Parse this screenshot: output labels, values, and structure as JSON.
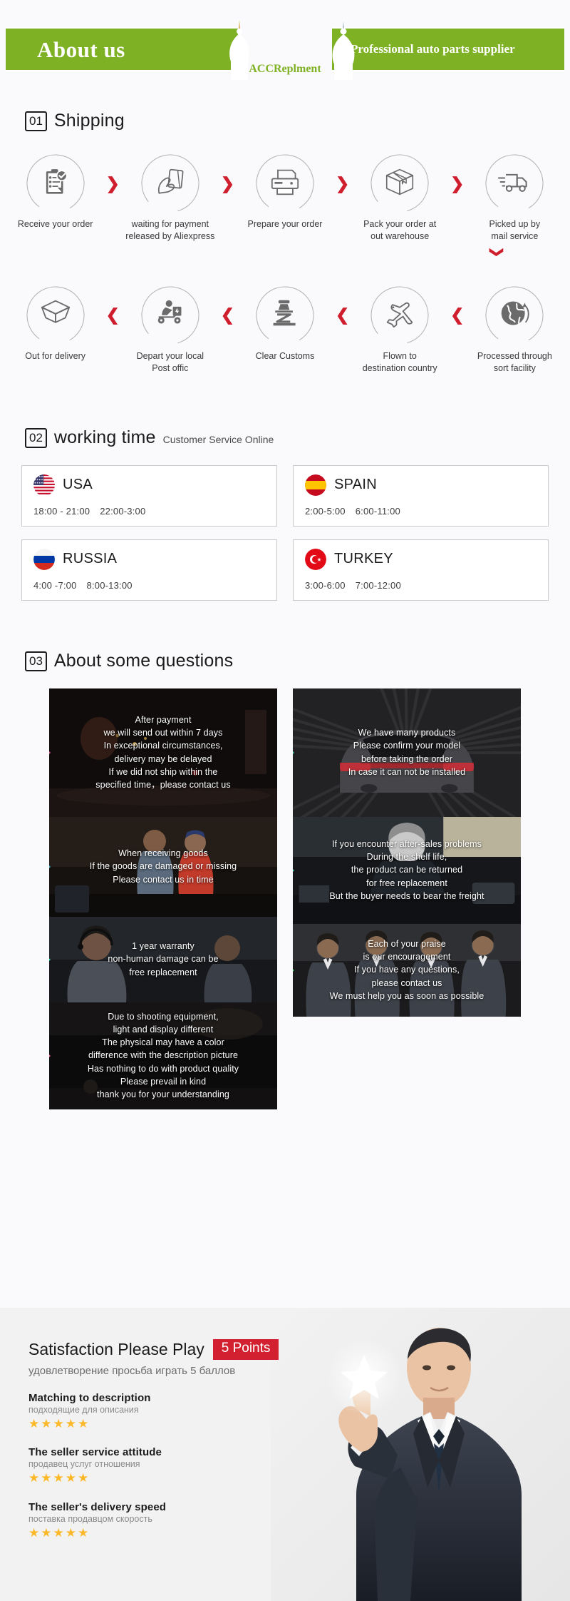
{
  "header": {
    "title": "About us",
    "tagline": "Professional auto parts supplier",
    "logo": "ACCReplment",
    "brand_green": "#7fb125"
  },
  "shipping": {
    "number": "01",
    "name": "Shipping",
    "row1": [
      {
        "label": "Receive your order",
        "icon": "clipboard-check-icon"
      },
      {
        "label": "waiting for payment\nreleased by Aliexpress",
        "icon": "hand-card-icon"
      },
      {
        "label": "Prepare your order",
        "icon": "printer-icon"
      },
      {
        "label": "Pack your order at\nout warehouse",
        "icon": "box-icon"
      },
      {
        "label": "Picked up by\nmail service",
        "icon": "truck-icon"
      }
    ],
    "row2": [
      {
        "label": "Out  for delivery",
        "icon": "open-box-icon"
      },
      {
        "label": "Depart your local\nPost offic",
        "icon": "scooter-courier-icon"
      },
      {
        "label": "Clear Customs",
        "icon": "customs-stamp-icon"
      },
      {
        "label": "Flown to\ndestination country",
        "icon": "airplane-icon"
      },
      {
        "label": "Processed through\nsort facility",
        "icon": "globe-icon"
      }
    ],
    "arrow_right": "❯",
    "arrow_left": "❮",
    "arrow_down": "❯",
    "arrow_color": "#cf1f2e"
  },
  "working_time": {
    "number": "02",
    "name": "working time",
    "subtitle": "Customer Service Online",
    "cards": [
      {
        "country": "USA",
        "flag": "usa-flag-icon",
        "hours": [
          "18:00 - 21:00",
          "22:00-3:00"
        ]
      },
      {
        "country": "SPAIN",
        "flag": "spain-flag-icon",
        "hours": [
          "2:00-5:00",
          "6:00-11:00"
        ]
      },
      {
        "country": "RUSSIA",
        "flag": "russia-flag-icon",
        "hours": [
          "4:00 -7:00",
          "8:00-13:00"
        ]
      },
      {
        "country": "TURKEY",
        "flag": "turkey-flag-icon",
        "hours": [
          "3:00-6:00",
          "7:00-12:00"
        ]
      }
    ]
  },
  "questions": {
    "number": "03",
    "name": "About some questions",
    "left_panels": [
      {
        "text": "After payment\nwe will send out within 7 days\nIn exceptional circumstances,\ndelivery may be delayed\nIf we did not ship within the\nspecified time，please contact us",
        "tag_color": "pink",
        "scene": "night-street"
      },
      {
        "text": "When receiving goods\nIf the goods are damaged or missing\nPlease contact us in time",
        "tag_color": "blue",
        "scene": "delivery-men"
      },
      {
        "text": "1 year warranty\nnon-human damage can be\nfree replacement",
        "tag_color": "teal",
        "scene": "headset-agent"
      },
      {
        "text": "Due to shooting equipment,\nlight and display different\nThe physical may have a color\ndifference with the description picture\nHas nothing to do with product quality\nPlease prevail in kind\nthank you for your understanding",
        "tag_color": "pink",
        "scene": "dark-workshop"
      }
    ],
    "right_panels": [
      {
        "text": "We have many products\nPlease confirm your model\nbefore taking the order\nIn case it can not be installed",
        "tag_color": "teal",
        "scene": "car-rear"
      },
      {
        "text": "If you encounter after-sales problems\nDuring the shelf life,\nthe product can be returned\nfor free replacement\nBut the buyer needs to bear the freight",
        "tag_color": "teal",
        "scene": "mechanic-engine"
      },
      {
        "text": "Each of your praise\nis our encouragement\nIf you have any questions,\nplease contact us\nWe must help you as soon as possible",
        "tag_color": "green",
        "scene": "team-group"
      }
    ]
  },
  "satisfaction": {
    "title": "Satisfaction Please Play",
    "badge": "5 Points",
    "subtitle": "удовлетворение просьба играть 5 баллов",
    "ratings": [
      {
        "en": "Matching to description",
        "ru": "подходящие для описания",
        "stars": 5
      },
      {
        "en": "The seller service attitude",
        "ru": "продавец услуг отношения",
        "stars": 5
      },
      {
        "en": "The seller's delivery speed",
        "ru": "поставка продавцом скорость",
        "stars": 5
      }
    ],
    "star_glyph": "★",
    "star_color": "#fbb92a",
    "badge_color": "#d32030"
  }
}
